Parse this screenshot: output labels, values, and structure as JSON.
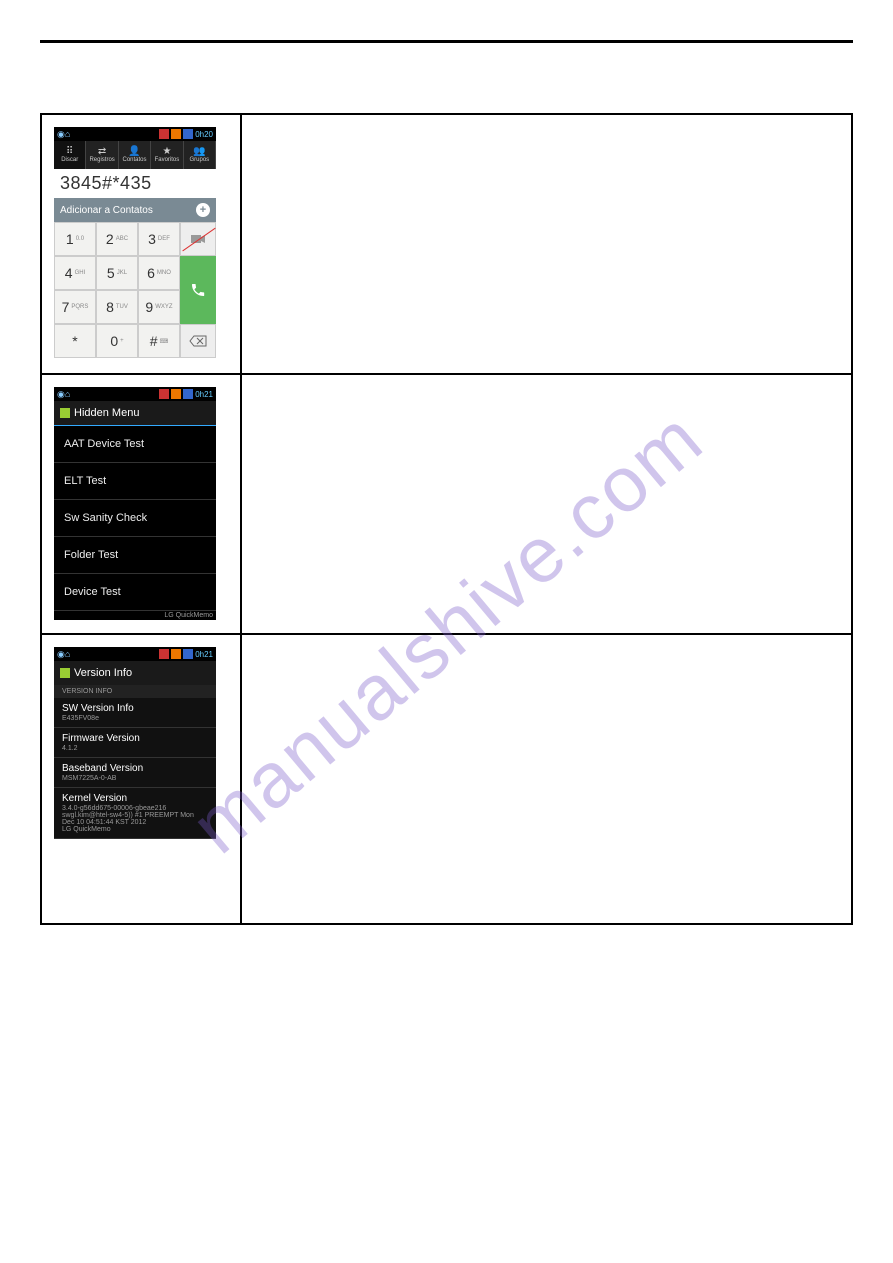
{
  "statusbar": {
    "time1": "0h20",
    "time2": "0h21",
    "time3": "0h21"
  },
  "dialer": {
    "tabs": [
      {
        "icon": "⠿",
        "label": "Discar"
      },
      {
        "icon": "⇄",
        "label": "Registros"
      },
      {
        "icon": "👤",
        "label": "Contatos"
      },
      {
        "icon": "★",
        "label": "Favoritos"
      },
      {
        "icon": "👥",
        "label": "Grupos"
      }
    ],
    "entered": "3845#*435",
    "add_contact": "Adicionar a Contatos",
    "keys": [
      [
        {
          "n": "1",
          "l": "0.0"
        },
        {
          "n": "2",
          "l": "ABC"
        },
        {
          "n": "3",
          "l": "DEF"
        }
      ],
      [
        {
          "n": "4",
          "l": "GHI"
        },
        {
          "n": "5",
          "l": "JKL"
        },
        {
          "n": "6",
          "l": "MNO"
        }
      ],
      [
        {
          "n": "7",
          "l": "PQRS"
        },
        {
          "n": "8",
          "l": "TUV"
        },
        {
          "n": "9",
          "l": "WXYZ"
        }
      ],
      [
        {
          "n": "*",
          "l": ""
        },
        {
          "n": "0",
          "l": "+"
        },
        {
          "n": "#",
          "l": "⌨"
        }
      ]
    ]
  },
  "hidden_menu": {
    "title": "Hidden Menu",
    "items": [
      "AAT Device Test",
      "ELT Test",
      "Sw Sanity Check",
      "Folder Test",
      "Device Test"
    ],
    "memo": "LG QuickMemo"
  },
  "version_info": {
    "title": "Version Info",
    "section": "VERSION INFO",
    "items": [
      {
        "t": "SW Version Info",
        "s": "E435FV08e"
      },
      {
        "t": "Firmware Version",
        "s": "4.1.2"
      },
      {
        "t": "Baseband Version",
        "s": "MSM7225A-0-AB"
      },
      {
        "t": "Kernel Version",
        "s": "3.4.0-g56dd675-00006-gbeae216 swgl.kim@htel-sw4-5)) #1 PREEMPT Mon Dec 10 04:51:44 KST 2012                            LG QuickMemo"
      }
    ]
  },
  "watermark": "manualshive.com"
}
